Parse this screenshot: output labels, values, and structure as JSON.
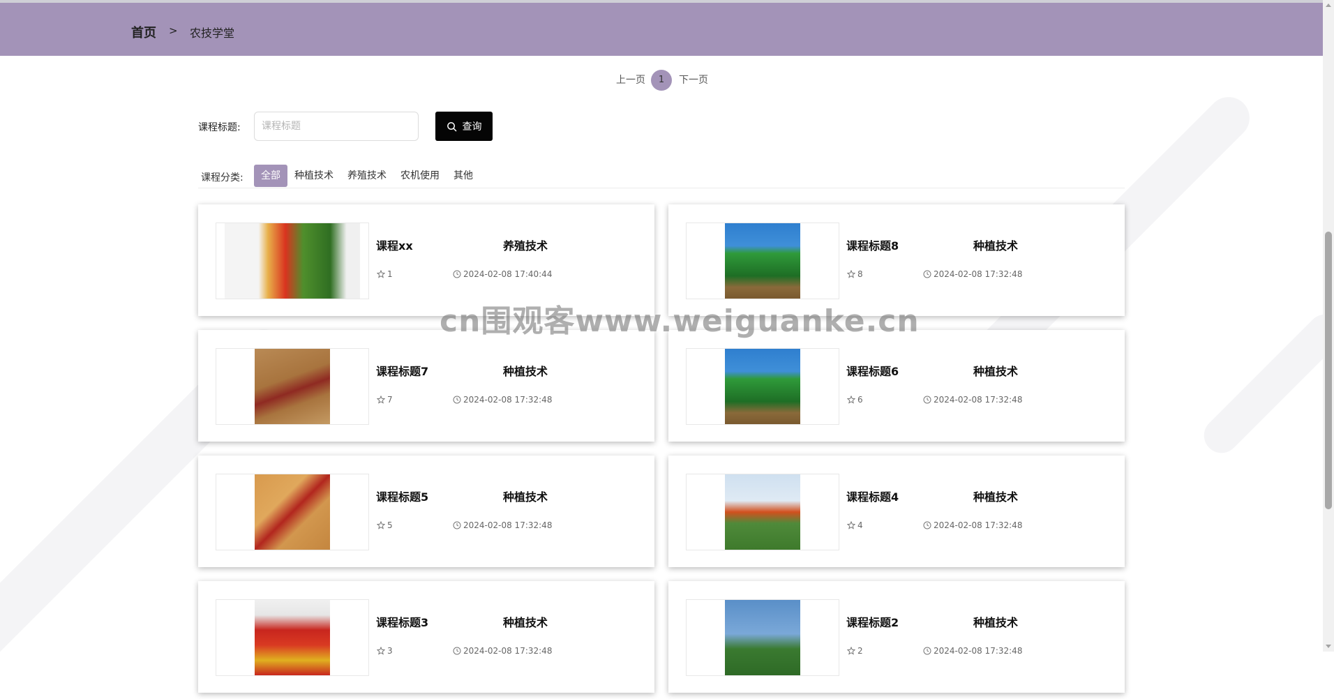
{
  "breadcrumb": {
    "home": "首页",
    "separator": ">",
    "current": "农技学堂"
  },
  "pagination": {
    "prev": "上一页",
    "current": "1",
    "next": "下一页"
  },
  "search": {
    "label": "课程标题:",
    "placeholder": "课程标题",
    "value": "",
    "button": "查询"
  },
  "categories": {
    "label": "课程分类:",
    "items": [
      "全部",
      "种植技术",
      "养殖技术",
      "农机使用",
      "其他"
    ],
    "active": "全部"
  },
  "courses": [
    {
      "title": "课程xx",
      "category": "养殖技术",
      "favorites": "1",
      "time": "2024-02-08 17:40:44"
    },
    {
      "title": "课程标题8",
      "category": "种植技术",
      "favorites": "8",
      "time": "2024-02-08 17:32:48"
    },
    {
      "title": "课程标题7",
      "category": "种植技术",
      "favorites": "7",
      "time": "2024-02-08 17:32:48"
    },
    {
      "title": "课程标题6",
      "category": "种植技术",
      "favorites": "6",
      "time": "2024-02-08 17:32:48"
    },
    {
      "title": "课程标题5",
      "category": "种植技术",
      "favorites": "5",
      "time": "2024-02-08 17:32:48"
    },
    {
      "title": "课程标题4",
      "category": "种植技术",
      "favorites": "4",
      "time": "2024-02-08 17:32:48"
    },
    {
      "title": "课程标题3",
      "category": "种植技术",
      "favorites": "3",
      "time": "2024-02-08 17:32:48"
    },
    {
      "title": "课程标题2",
      "category": "种植技术",
      "favorites": "2",
      "time": "2024-02-08 17:32:48"
    }
  ],
  "watermark": "cn围观客www.weiguanke.cn",
  "colors": {
    "accent": "#a393b8",
    "button": "#050505",
    "background": "#ffffff"
  },
  "icons": {
    "search": "search-icon",
    "favorite": "star-icon",
    "time": "clock-icon"
  }
}
